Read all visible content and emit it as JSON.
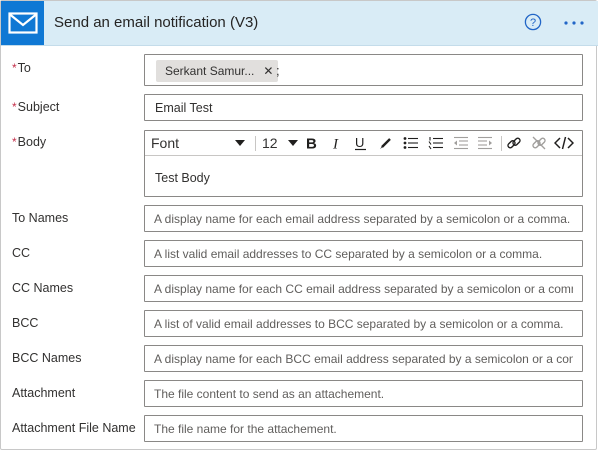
{
  "header": {
    "title": "Send an email notification (V3)",
    "accent_color": "#0f78d4",
    "icon": "mail-icon",
    "help_icon": "help-circle-icon",
    "more_icon": "more-options-icon"
  },
  "fields": {
    "to": {
      "label": "To",
      "required": true,
      "chip": "Serkant Samur...",
      "separator": ";"
    },
    "subject": {
      "label": "Subject",
      "required": true,
      "value": "Email Test"
    },
    "body": {
      "label": "Body",
      "required": true,
      "font": "Font",
      "font_size": "12",
      "content": "Test Body"
    },
    "to_names": {
      "label": "To Names",
      "placeholder": "A display name for each email address separated by a semicolon or a comma."
    },
    "cc": {
      "label": "CC",
      "placeholder": "A list valid email addresses to CC separated by a semicolon or a comma."
    },
    "cc_names": {
      "label": "CC Names",
      "placeholder": "A display name for each CC email address separated by a semicolon or a comm"
    },
    "bcc": {
      "label": "BCC",
      "placeholder": "A list of valid email addresses to BCC separated by a semicolon or a comma."
    },
    "bcc_names": {
      "label": "BCC Names",
      "placeholder": "A display name for each BCC email address separated by a semicolon or a comr"
    },
    "attachment": {
      "label": "Attachment",
      "placeholder": "The file content to send as an attachement."
    },
    "attachment_file_name": {
      "label": "Attachment File Name",
      "placeholder": "The file name for the attachement."
    }
  },
  "required_marker": "*",
  "required_color": "#c4314b"
}
